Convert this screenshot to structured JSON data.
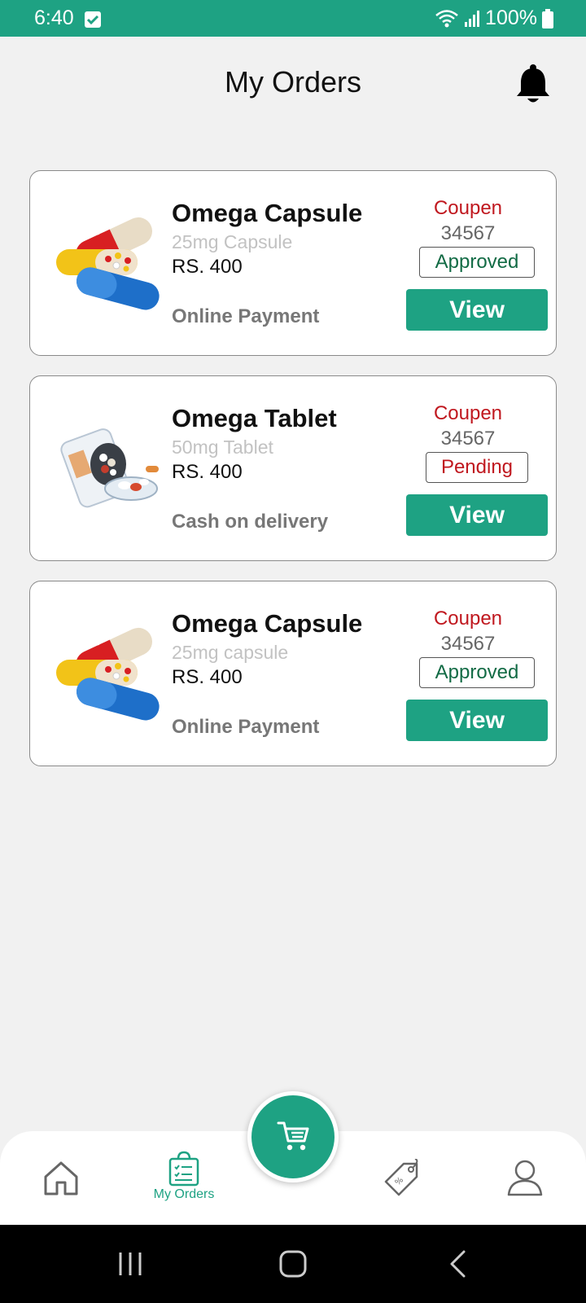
{
  "status_bar": {
    "time": "6:40",
    "battery": "100%"
  },
  "header": {
    "title": "My Orders"
  },
  "orders": [
    {
      "name": "Omega Capsule",
      "subtitle": "25mg Capsule",
      "price": "RS. 400",
      "payment": "Online Payment",
      "coupon_label": "Coupen",
      "coupon_code": "34567",
      "status": "Approved",
      "view_label": "View",
      "image": "capsule-image"
    },
    {
      "name": "Omega Tablet",
      "subtitle": "50mg Tablet",
      "price": "RS. 400",
      "payment": "Cash on delivery",
      "coupon_label": "Coupen",
      "coupon_code": "34567",
      "status": "Pending",
      "view_label": "View",
      "image": "tablet-bottle-image"
    },
    {
      "name": "Omega Capsule",
      "subtitle": "25mg capsule",
      "price": "RS. 400",
      "payment": "Online Payment",
      "coupon_label": "Coupen",
      "coupon_code": "34567",
      "status": "Approved",
      "view_label": "View",
      "image": "capsule-image"
    }
  ],
  "bottom_nav": {
    "items": [
      {
        "icon": "home-icon"
      },
      {
        "icon": "orders-bag-icon",
        "label": "My Orders",
        "active": true
      },
      {
        "icon": "cart-icon"
      },
      {
        "icon": "offers-tag-icon"
      },
      {
        "icon": "profile-icon"
      }
    ]
  },
  "colors": {
    "primary": "#1ea283",
    "coupon_red": "#c0181f",
    "approved_green": "#126b45",
    "background": "#f1f1f1"
  }
}
